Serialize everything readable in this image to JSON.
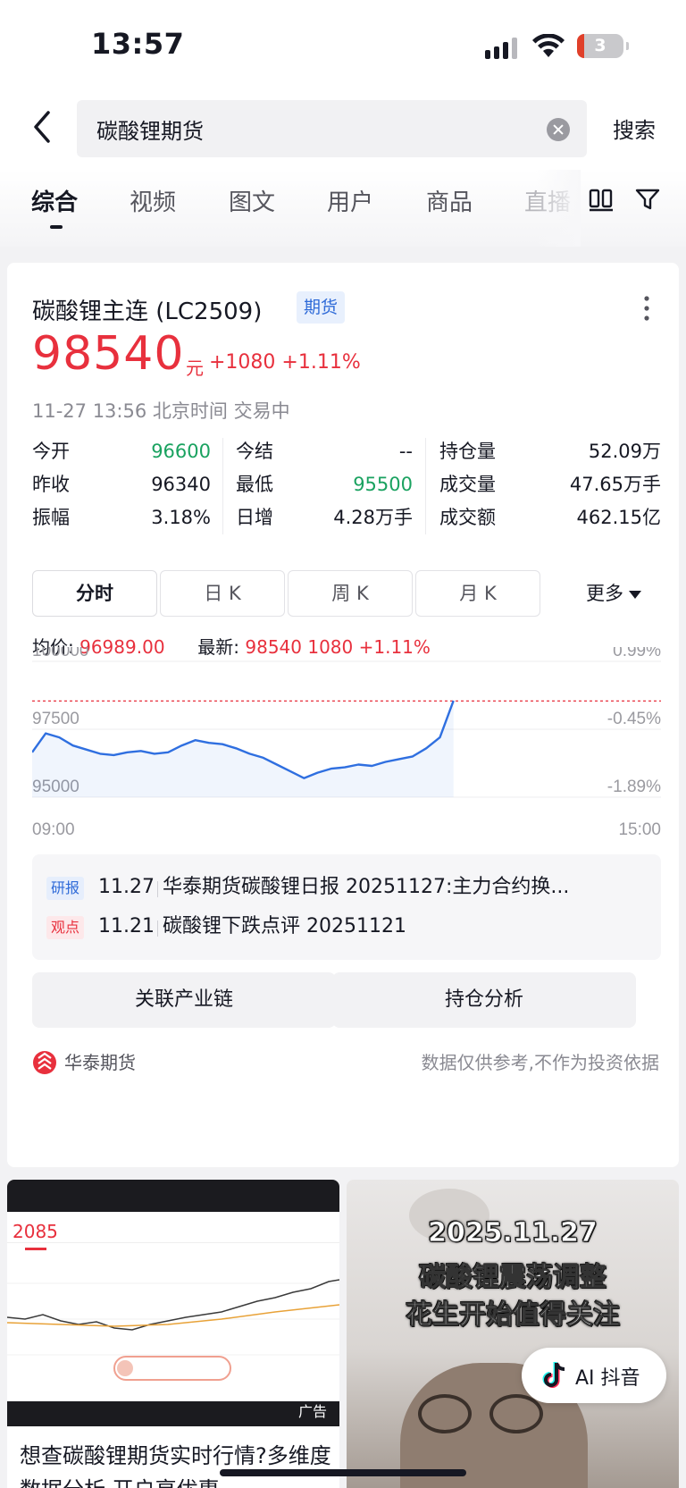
{
  "status": {
    "time": "13:57",
    "battery": "3"
  },
  "search": {
    "query": "碳酸锂期货",
    "button": "搜索"
  },
  "tabs": [
    {
      "label": "综合"
    },
    {
      "label": "视频"
    },
    {
      "label": "图文"
    },
    {
      "label": "用户"
    },
    {
      "label": "商品"
    },
    {
      "label": "直播"
    }
  ],
  "card": {
    "name": "碳酸锂主连 (LC2509)",
    "tag": "期货",
    "price": "98540",
    "unit": "元",
    "change": "+1080 +1.11%",
    "timeline": "11-27 13:56 北京时间 交易中",
    "stats": [
      {
        "label": "今开",
        "value": "96600",
        "color": "green"
      },
      {
        "label": "今结",
        "value": "--",
        "color": "normal"
      },
      {
        "label": "持仓量",
        "value": "52.09万",
        "color": "normal"
      },
      {
        "label": "昨收",
        "value": "96340",
        "color": "normal"
      },
      {
        "label": "最低",
        "value": "95500",
        "color": "green"
      },
      {
        "label": "成交量",
        "value": "47.65万手",
        "color": "normal"
      },
      {
        "label": "振幅",
        "value": "3.18%",
        "color": "normal"
      },
      {
        "label": "日增",
        "value": "4.28万手",
        "color": "normal"
      },
      {
        "label": "成交额",
        "value": "462.15亿",
        "color": "normal"
      }
    ],
    "ktabs": [
      "分时",
      "日 K",
      "周 K",
      "月 K"
    ],
    "ktab_more": "更多",
    "avg_label": "均价:",
    "avg_value": "96989.00",
    "latest_label": "最新:",
    "latest_value": "98540 1080 +1.11%",
    "news": [
      {
        "tag": "研报",
        "date": "11.27",
        "title": "华泰期货碳酸锂日报 20251127:主力合约换..."
      },
      {
        "tag": "观点",
        "date": "11.21",
        "title": "碳酸锂下跌点评 20251121"
      }
    ],
    "buttons": [
      "关联产业链",
      "持仓分析"
    ],
    "brand": "华泰期货",
    "disclaimer": "数据仅供参考,不作为投资依据"
  },
  "chart_data": {
    "type": "line",
    "x_start": "09:00",
    "x_end": "15:00",
    "y_left_ticks": [
      "100000",
      "97500",
      "95000"
    ],
    "y_right_ticks": [
      "0.99%",
      "-0.45%",
      "-1.89%"
    ],
    "ylim": [
      95000,
      100000
    ],
    "reference_value": 98540,
    "progress_fraction": 0.67,
    "series": [
      {
        "values": [
          96650,
          97350,
          97200,
          96900,
          96750,
          96600,
          96550,
          96650,
          96700,
          96600,
          96650,
          96900,
          97100,
          97000,
          96950,
          96800,
          96600,
          96450,
          96200,
          95950,
          95700,
          95900,
          96050,
          96100,
          96200,
          96150,
          96300,
          96400,
          96500,
          96800,
          97200,
          98550
        ]
      }
    ],
    "color": "#2f6fe0"
  },
  "feed": {
    "left": {
      "title": "想查碳酸锂期货实时行情?多维度数据分析,开户享优惠",
      "ad": "广告"
    },
    "right": {
      "line1": "2025.11.27",
      "line2": "碳酸锂震荡调整",
      "line3": "花生开始值得关注",
      "ai_label": "AI 抖音"
    }
  }
}
